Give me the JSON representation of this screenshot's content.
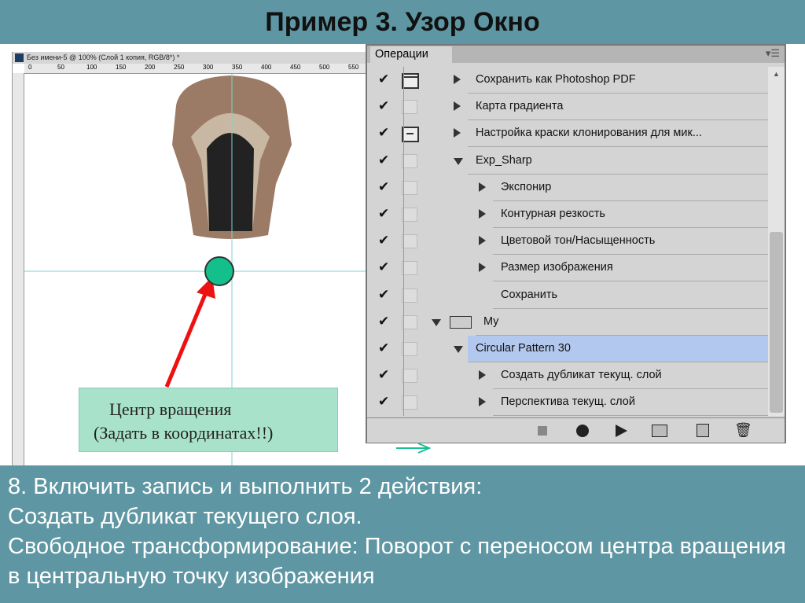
{
  "slide_title": "Пример 3. Узор Окно",
  "document": {
    "title": "Без имени-5 @ 100% (Слой 1 копия, RGB/8*) *",
    "ruler_labels": [
      "0",
      "50",
      "100",
      "150",
      "200",
      "250",
      "300",
      "350",
      "400",
      "450",
      "500",
      "550"
    ]
  },
  "callout": {
    "line1": "Центр вращения",
    "line2": "(Задать в координатах!!)",
    "bg": "#a9e2cb"
  },
  "panel": {
    "tab": "Операции",
    "rows": [
      {
        "label": "Сохранить как Photoshop PDF",
        "level": 0,
        "expanded": false,
        "dialog": "window"
      },
      {
        "label": "Карта градиента",
        "level": 0,
        "expanded": false,
        "dialog": "none"
      },
      {
        "label": "Настройка краски клонирования для мик...",
        "level": 0,
        "expanded": false,
        "dialog": "window-minus"
      },
      {
        "label": "Exp_Sharp",
        "level": 0,
        "expanded": true,
        "dialog": "none"
      },
      {
        "label": "Экспонир",
        "level": 1,
        "expanded": false,
        "dialog": "none"
      },
      {
        "label": "Контурная резкость",
        "level": 1,
        "expanded": false,
        "dialog": "none"
      },
      {
        "label": "Цветовой тон/Насыщенность",
        "level": 1,
        "expanded": false,
        "dialog": "none"
      },
      {
        "label": "Размер изображения",
        "level": 1,
        "expanded": false,
        "dialog": "none"
      },
      {
        "label": "Сохранить",
        "level": 1,
        "expanded": null,
        "dialog": "none"
      },
      {
        "label": "My",
        "level": -1,
        "expanded": true,
        "dialog": "none",
        "folder": true
      },
      {
        "label": "Circular Pattern 30",
        "level": 0,
        "expanded": true,
        "dialog": "none",
        "selected": true
      },
      {
        "label": "Создать дубликат текущ. слой",
        "level": 1,
        "expanded": false,
        "dialog": "none"
      },
      {
        "label": "Перспектива текущ. слой",
        "level": 1,
        "expanded": false,
        "dialog": "none"
      }
    ],
    "toolbar": [
      "stop-icon",
      "record-icon",
      "play-icon",
      "new-set-icon",
      "new-action-icon",
      "trash-icon"
    ]
  },
  "instructions": [
    "8. Включить запись и выполнить 2 действия:",
    "Создать дубликат текущего слоя.",
    "Свободное трансформирование: Поворот с переносом центра вращения в центральную точку изображения"
  ]
}
